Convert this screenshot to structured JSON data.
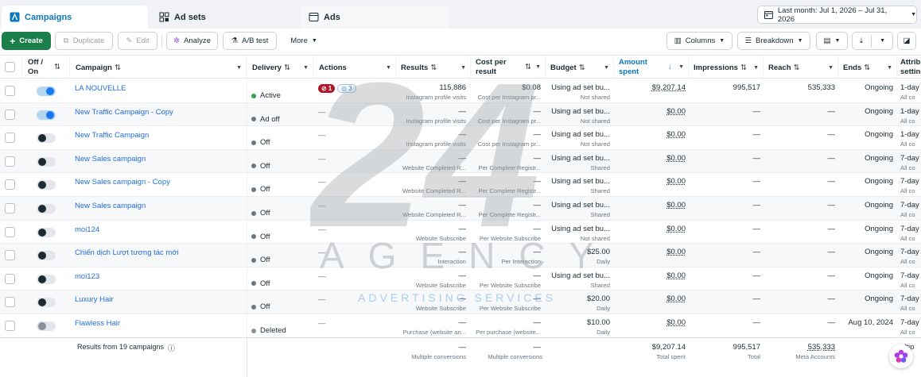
{
  "tabs": [
    {
      "label": "Campaigns",
      "active": true
    },
    {
      "label": "Ad sets"
    },
    {
      "label": "Ads"
    }
  ],
  "date_range": "Last month: Jul 1, 2026 – Jul 31, 2026",
  "toolbar": {
    "create": "Create",
    "duplicate": "Duplicate",
    "edit": "Edit",
    "analyze": "Analyze",
    "ab_test": "A/B test",
    "more": "More",
    "columns": "Columns",
    "breakdown": "Breakdown"
  },
  "headers": {
    "off_on": "Off / On",
    "campaign": "Campaign",
    "delivery": "Delivery",
    "actions": "Actions",
    "results": "Results",
    "cost_per_result": "Cost per result",
    "budget": "Budget",
    "amount_spent": "Amount spent",
    "impressions": "Impressions",
    "reach": "Reach",
    "ends": "Ends",
    "attribution": "Attribution setting"
  },
  "rows": [
    {
      "name": "LA NOUVELLE",
      "toggle": "on",
      "delivery": "Active",
      "dot": "green",
      "actions": true,
      "badge_red": "1",
      "badge_blue": "3",
      "results": "115,886",
      "results_sub": "Instagram profile visits",
      "cost": "$0.08",
      "cost_sub": "Cost per Instagram pr...",
      "budget": "Using ad set bu...",
      "budget_sub": "Not shared",
      "spent": "$9,207.14",
      "impressions": "995,517",
      "reach": "535,333",
      "ends": "Ongoing",
      "attr": "1-day",
      "attr_sub": "All co"
    },
    {
      "name": "New Traffic Campaign - Copy",
      "toggle": "on",
      "delivery": "Ad off",
      "dot": "",
      "results": "—",
      "results_sub": "Instagram profile visits",
      "cost": "—",
      "cost_sub": "Cost per Instagram pr...",
      "budget": "Using ad set bu...",
      "budget_sub": "Not shared",
      "spent": "$0.00",
      "impressions": "—",
      "reach": "—",
      "ends": "Ongoing",
      "attr": "1-day",
      "attr_sub": "All co"
    },
    {
      "name": "New Traffic Campaign",
      "toggle": "off",
      "delivery": "Off",
      "dot": "",
      "results": "—",
      "results_sub": "Instagram profile visits",
      "cost": "—",
      "cost_sub": "Cost per Instagram pr...",
      "budget": "Using ad set bu...",
      "budget_sub": "Not shared",
      "spent": "$0.00",
      "impressions": "—",
      "reach": "—",
      "ends": "Ongoing",
      "attr": "1-day",
      "attr_sub": "All co"
    },
    {
      "name": "New Sales campaign",
      "toggle": "off",
      "delivery": "Off",
      "dot": "",
      "results": "—",
      "results_sub": "Website Completed R...",
      "cost": "—",
      "cost_sub": "Per Complete Registr...",
      "budget": "Using ad set bu...",
      "budget_sub": "Shared",
      "spent": "$0.00",
      "impressions": "—",
      "reach": "—",
      "ends": "Ongoing",
      "attr": "7-day",
      "attr_sub": "All co"
    },
    {
      "name": "New Sales campaign - Copy",
      "toggle": "off",
      "delivery": "Off",
      "dot": "",
      "results": "—",
      "results_sub": "Website Completed R...",
      "cost": "—",
      "cost_sub": "Per Complete Registr...",
      "budget": "Using ad set bu...",
      "budget_sub": "Shared",
      "spent": "$0.00",
      "impressions": "—",
      "reach": "—",
      "ends": "Ongoing",
      "attr": "7-day",
      "attr_sub": "All co"
    },
    {
      "name": "New Sales campaign",
      "toggle": "off",
      "delivery": "Off",
      "dot": "",
      "results": "—",
      "results_sub": "Website Completed R...",
      "cost": "—",
      "cost_sub": "Per Complete Registr...",
      "budget": "Using ad set bu...",
      "budget_sub": "Shared",
      "spent": "$0.00",
      "impressions": "—",
      "reach": "—",
      "ends": "Ongoing",
      "attr": "7-day",
      "attr_sub": "All co"
    },
    {
      "name": "moi124",
      "toggle": "off",
      "delivery": "Off",
      "dot": "",
      "results": "—",
      "results_sub": "Website Subscribe",
      "cost": "—",
      "cost_sub": "Per Website Subscribe",
      "budget": "Using ad set bu...",
      "budget_sub": "Not shared",
      "spent": "$0.00",
      "impressions": "—",
      "reach": "—",
      "ends": "Ongoing",
      "attr": "7-day",
      "attr_sub": "All co"
    },
    {
      "name": "Chiến dịch Lượt tương tác mới",
      "toggle": "off",
      "delivery": "Off",
      "dot": "",
      "results": "—",
      "results_sub": "Interaction",
      "cost": "—",
      "cost_sub": "Per Interaction",
      "budget": "$25.00",
      "budget_sub": "Daily",
      "spent": "$0.00",
      "impressions": "—",
      "reach": "—",
      "ends": "Ongoing",
      "attr": "7-day",
      "attr_sub": "All co"
    },
    {
      "name": "moi123",
      "toggle": "off",
      "delivery": "Off",
      "dot": "",
      "results": "—",
      "results_sub": "Website Subscribe",
      "cost": "—",
      "cost_sub": "Per Website Subscribe",
      "budget": "Using ad set bu...",
      "budget_sub": "Shared",
      "spent": "$0.00",
      "impressions": "—",
      "reach": "—",
      "ends": "Ongoing",
      "attr": "7-day",
      "attr_sub": "All co"
    },
    {
      "name": "Luxury Hair",
      "toggle": "off",
      "delivery": "Off",
      "dot": "",
      "results": "—",
      "results_sub": "Website Subscribe",
      "cost": "—",
      "cost_sub": "Per Website Subscribe",
      "budget": "$20.00",
      "budget_sub": "Daily",
      "spent": "$0.00",
      "impressions": "—",
      "reach": "—",
      "ends": "Ongoing",
      "attr": "7-day",
      "attr_sub": "All co"
    },
    {
      "name": "Flawless Hair",
      "toggle": "dis",
      "delivery": "Deleted",
      "dot": "gray",
      "results": "—",
      "results_sub": "Purchase (website an...",
      "cost": "—",
      "cost_sub": "Per purchase (website...",
      "budget": "$10.00",
      "budget_sub": "Daily",
      "spent": "$0.00",
      "impressions": "—",
      "reach": "—",
      "ends": "Aug 10, 2024",
      "attr": "7-day",
      "attr_sub": "All co"
    }
  ],
  "footer": {
    "label": "Results from 19 campaigns",
    "results": "—",
    "results_sub": "Multiple conversions",
    "cost": "—",
    "cost_sub": "Multiple conversions",
    "spent": "$9,207.14",
    "spent_sub": "Total spent",
    "impressions": "995,517",
    "impressions_sub": "Total",
    "reach": "535,333",
    "reach_sub": "Meta Accounts",
    "attr": "ultip"
  },
  "watermark": {
    "big": "24",
    "word": "AGENCY",
    "tagline": "ADVERTISING SERVICES"
  },
  "colors": {
    "brand_green": "#1a7f4b",
    "link_blue": "#216fdb",
    "active_green": "#31a24c",
    "error_red": "#b0172a"
  }
}
